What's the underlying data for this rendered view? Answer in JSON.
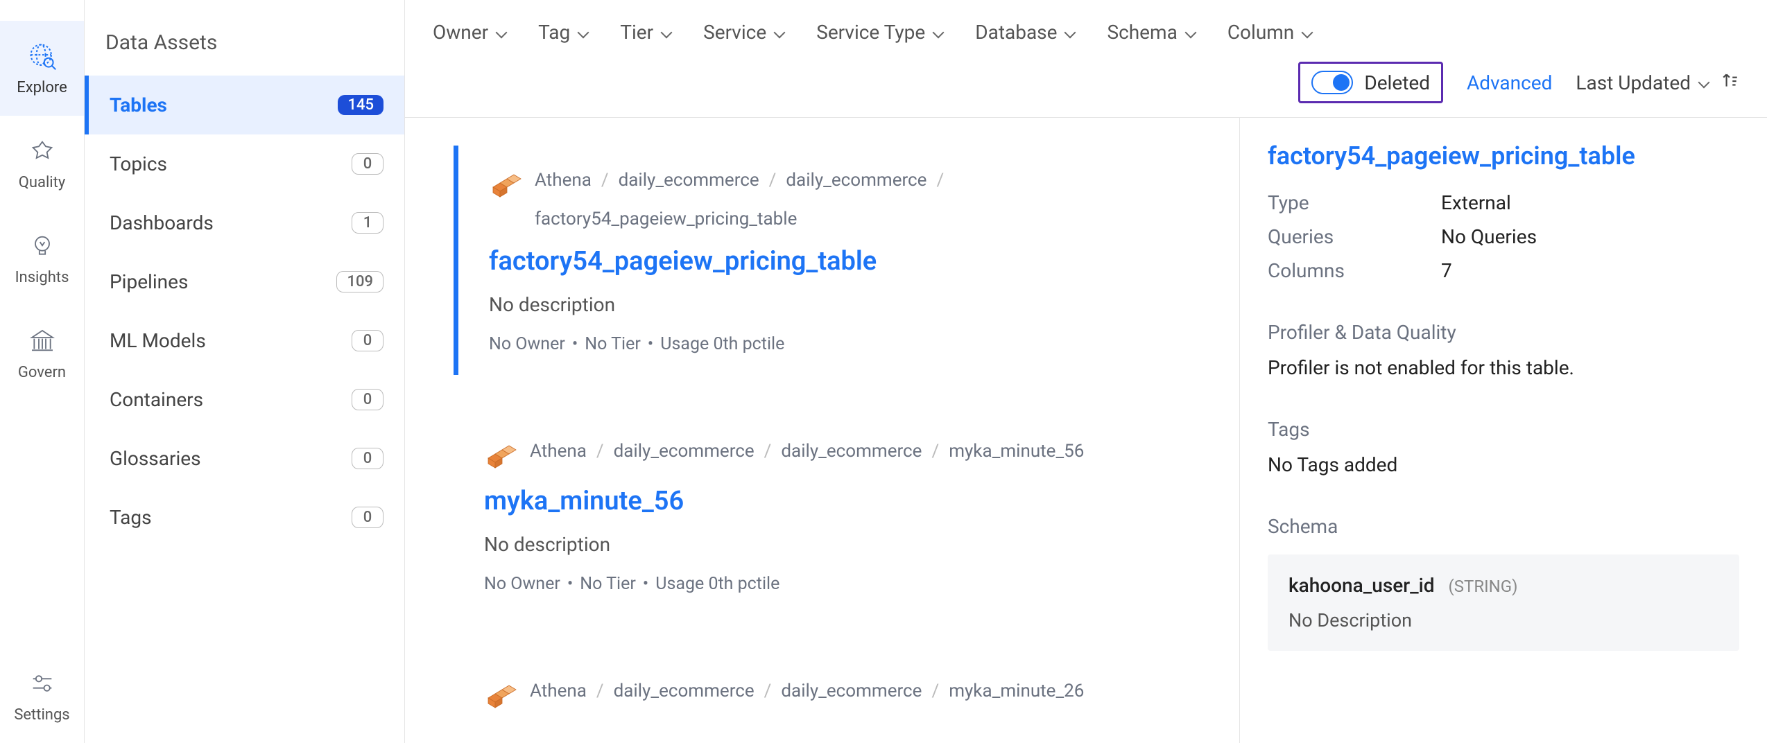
{
  "rail": [
    {
      "id": "explore",
      "label": "Explore",
      "active": true
    },
    {
      "id": "quality",
      "label": "Quality",
      "active": false
    },
    {
      "id": "insights",
      "label": "Insights",
      "active": false
    },
    {
      "id": "govern",
      "label": "Govern",
      "active": false
    },
    {
      "id": "settings",
      "label": "Settings",
      "active": false
    }
  ],
  "sidebar": {
    "title": "Data Assets",
    "items": [
      {
        "label": "Tables",
        "count": "145",
        "active": true
      },
      {
        "label": "Topics",
        "count": "0"
      },
      {
        "label": "Dashboards",
        "count": "1"
      },
      {
        "label": "Pipelines",
        "count": "109"
      },
      {
        "label": "ML Models",
        "count": "0"
      },
      {
        "label": "Containers",
        "count": "0"
      },
      {
        "label": "Glossaries",
        "count": "0"
      },
      {
        "label": "Tags",
        "count": "0"
      }
    ]
  },
  "filters": {
    "chips": [
      "Owner",
      "Tag",
      "Tier",
      "Service",
      "Service Type",
      "Database",
      "Schema",
      "Column"
    ],
    "deleted_label": "Deleted",
    "advanced_label": "Advanced",
    "sort_label": "Last Updated"
  },
  "results": [
    {
      "crumbs": [
        "Athena",
        "daily_ecommerce",
        "daily_ecommerce",
        "factory54_pageiew_pricing_table"
      ],
      "title": "factory54_pageiew_pricing_table",
      "desc": "No description",
      "meta": [
        "No Owner",
        "No Tier",
        "Usage 0th pctile"
      ],
      "active": true
    },
    {
      "crumbs": [
        "Athena",
        "daily_ecommerce",
        "daily_ecommerce",
        "myka_minute_56"
      ],
      "title": "myka_minute_56",
      "desc": "No description",
      "meta": [
        "No Owner",
        "No Tier",
        "Usage 0th pctile"
      ]
    },
    {
      "crumbs": [
        "Athena",
        "daily_ecommerce",
        "daily_ecommerce",
        "myka_minute_26"
      ],
      "title": "",
      "desc": "",
      "meta": []
    }
  ],
  "details": {
    "title": "factory54_pageiew_pricing_table",
    "kv": [
      {
        "k": "Type",
        "v": "External"
      },
      {
        "k": "Queries",
        "v": "No Queries"
      },
      {
        "k": "Columns",
        "v": "7"
      }
    ],
    "profiler_label": "Profiler & Data Quality",
    "profiler_text": "Profiler is not enabled for this table.",
    "tags_label": "Tags",
    "tags_text": "No Tags added",
    "schema_label": "Schema",
    "schema_col": {
      "name": "kahoona_user_id",
      "type": "(STRING)",
      "desc": "No Description"
    }
  }
}
